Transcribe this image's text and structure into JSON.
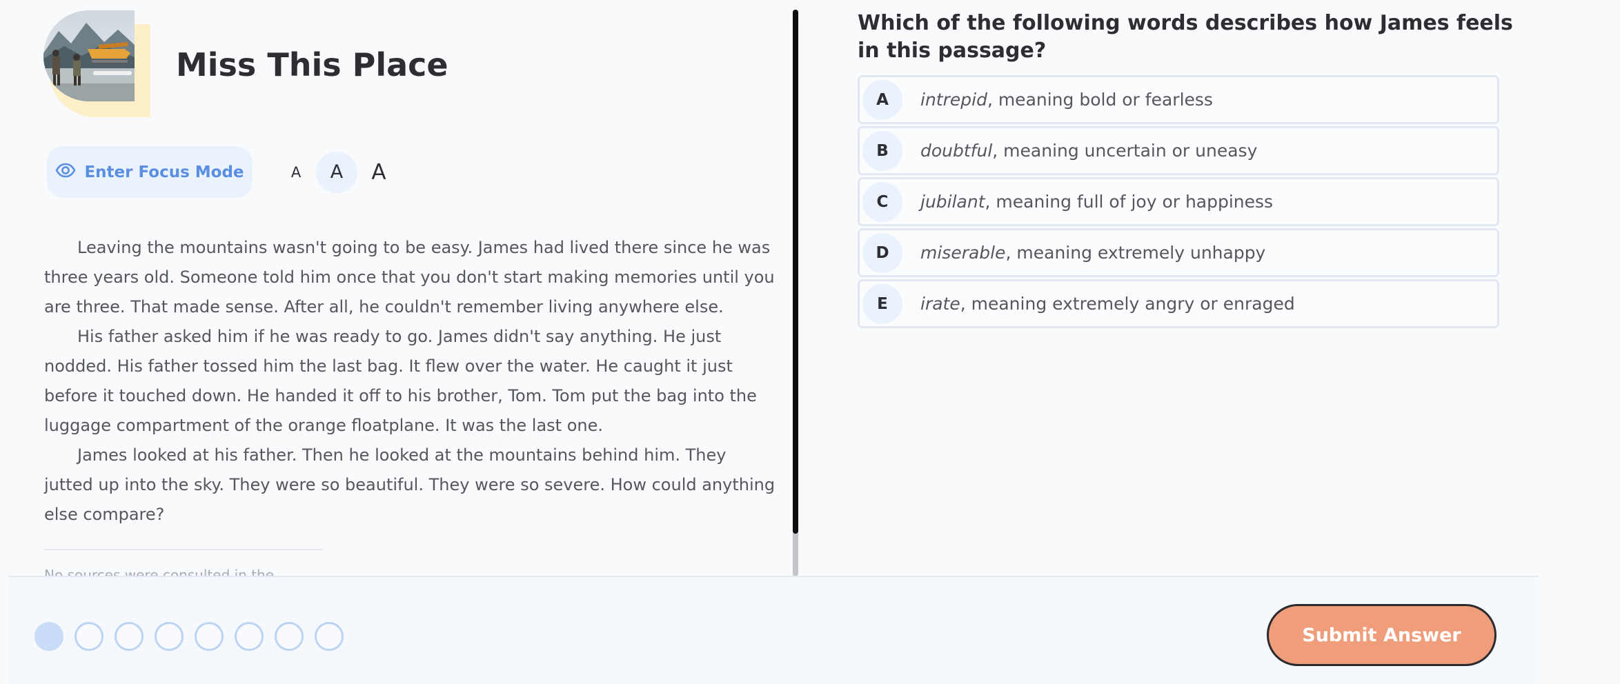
{
  "story": {
    "title": "Miss This Place",
    "image_icon": "floatplane-photo"
  },
  "toolbar": {
    "focus_label": "Enter Focus Mode",
    "focus_icon": "eye-icon",
    "font_sizes": [
      "A",
      "A",
      "A"
    ],
    "selected_font_size": "medium"
  },
  "passage": {
    "paragraphs": [
      "Leaving the mountains wasn't going to be easy. James had lived there since he was three years old. Someone told him once that you don't start making memories until you are three. That made sense. After all, he couldn't remember living anywhere else.",
      "His father asked him if he was ready to go. James didn't say anything. He just nodded. His father tossed him the last bag. It flew over the water. He caught it just before it touched down. He handed it off to his brother, Tom. Tom put the bag into the luggage compartment of the orange floatplane. It was the last one.",
      "James looked at his father. Then he looked at the mountains behind him. They jutted up into the sky. They were so beautiful. They were so severe. How could anything else compare?"
    ],
    "source_note": "No sources were consulted in the"
  },
  "question": {
    "text": "Which of the following words describes how James feels in this passage?",
    "options": [
      {
        "letter": "A",
        "word": "intrepid",
        "meaning": ", meaning bold or fearless"
      },
      {
        "letter": "B",
        "word": "doubtful",
        "meaning": ", meaning uncertain or uneasy"
      },
      {
        "letter": "C",
        "word": "jubilant",
        "meaning": ", meaning full of joy or happiness"
      },
      {
        "letter": "D",
        "word": "miserable",
        "meaning": ", meaning extremely unhappy"
      },
      {
        "letter": "E",
        "word": "irate",
        "meaning": ", meaning extremely angry or enraged"
      }
    ]
  },
  "footer": {
    "progress_total": 8,
    "progress_current": 1,
    "submit_label": "Submit Answer"
  },
  "colors": {
    "accent_blue": "#5a8ee0",
    "submit_orange": "#ef9d7a",
    "option_border": "#e2e8f4"
  }
}
